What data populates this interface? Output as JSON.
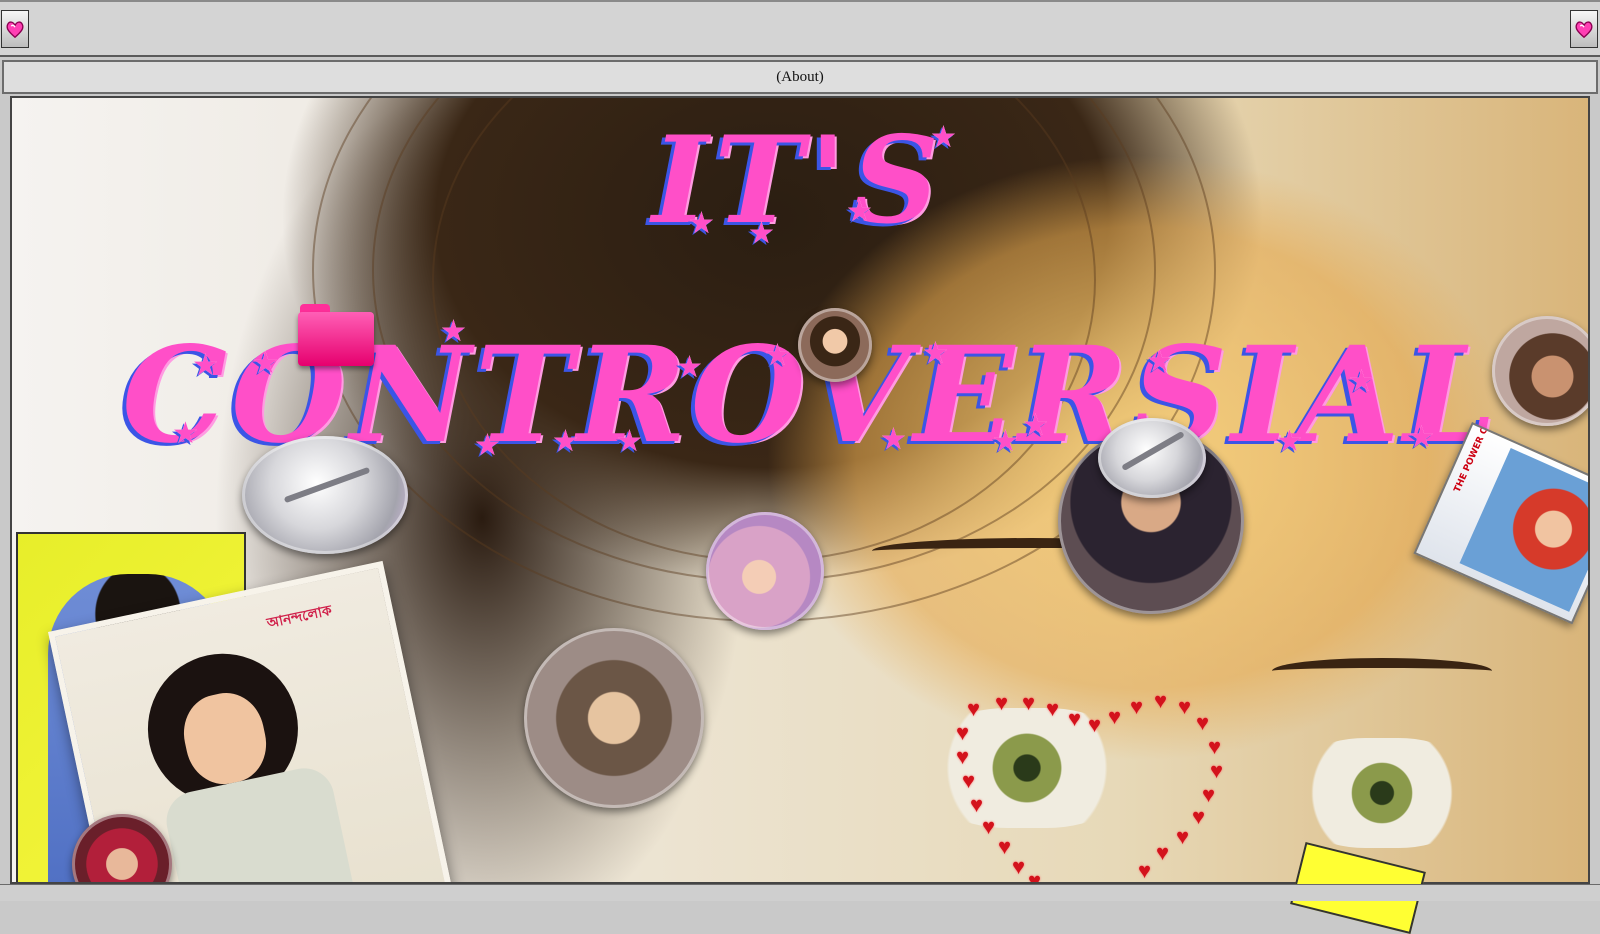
{
  "toolbar": {
    "left_icon": "heart-icon",
    "right_icon": "heart-icon"
  },
  "window": {
    "title": "(About)"
  },
  "content": {
    "title_line_1": "IT'S",
    "title_line_2": "CONTROVERSIAL",
    "folder_icon": "folder-icon",
    "poster_logo": "আনন্দলোক",
    "cassette_label": "THE POWER OF"
  },
  "colors": {
    "title_pink": "#ff4fc8",
    "title_shadow_blue": "#3b55e6",
    "folder_pink": "#e6006e",
    "heart_red": "#d3121c",
    "chrome_gray": "#d4d4d4"
  }
}
